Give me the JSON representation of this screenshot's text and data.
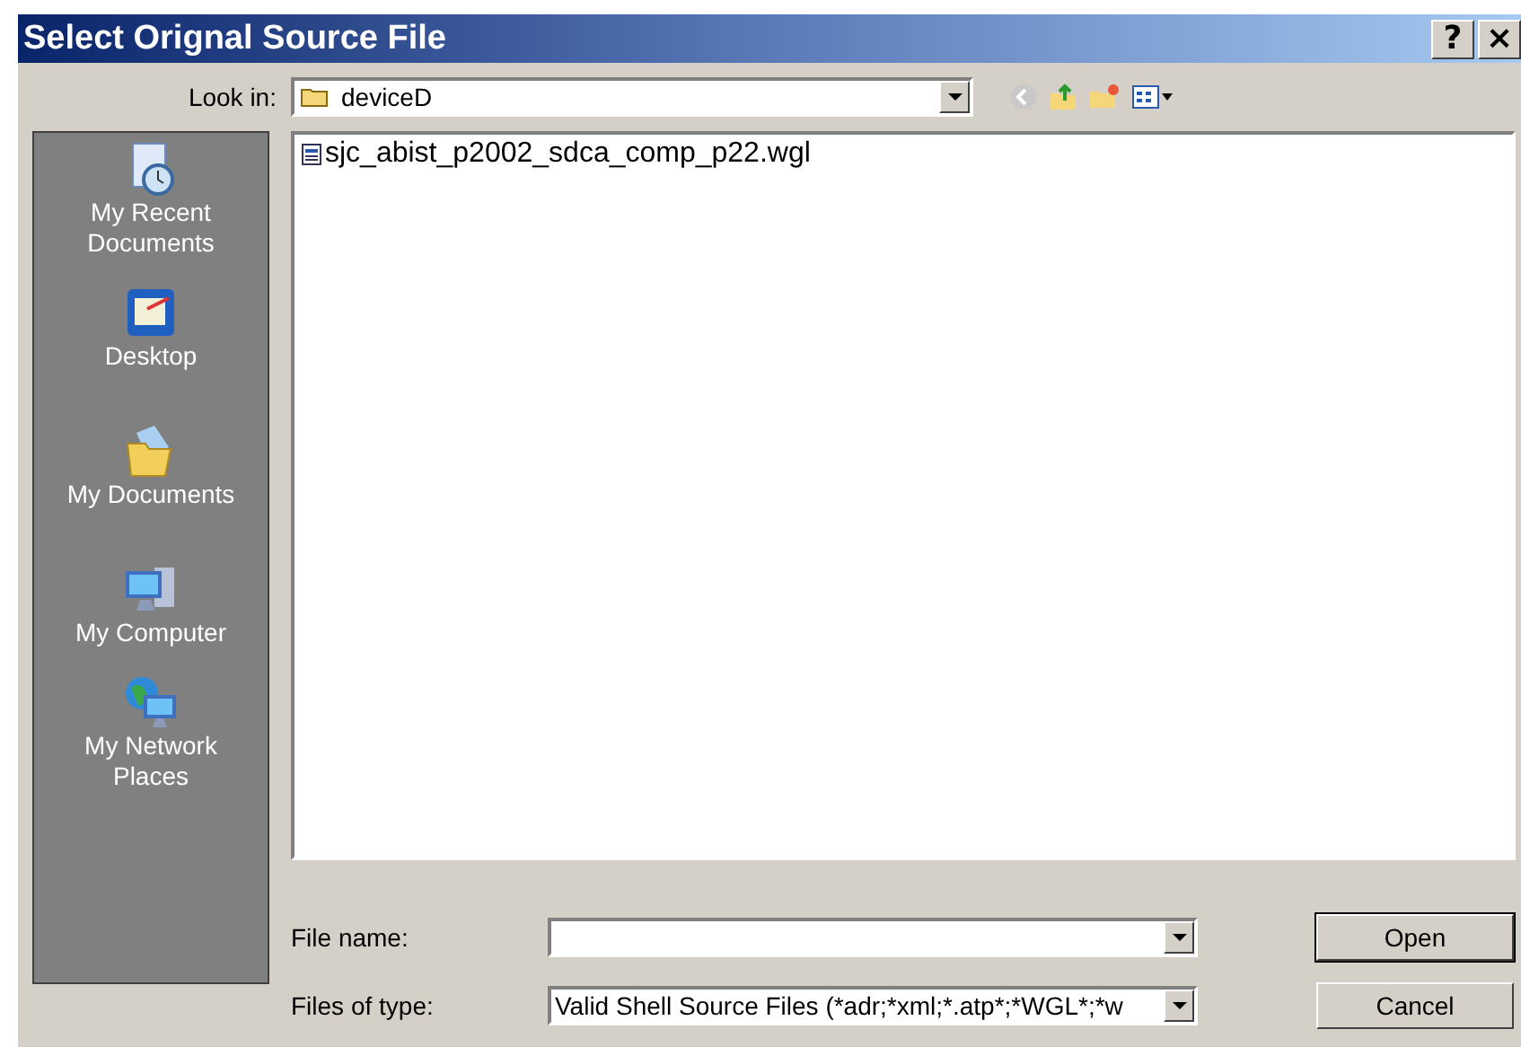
{
  "window": {
    "title": "Select Orignal Source File",
    "help_button": "?",
    "close_button": "×"
  },
  "look_in": {
    "label": "Look in:",
    "value": "deviceD"
  },
  "places": [
    {
      "kind": "recent",
      "label": "My Recent Documents"
    },
    {
      "kind": "desktop",
      "label": "Desktop"
    },
    {
      "kind": "documents",
      "label": "My Documents"
    },
    {
      "kind": "computer",
      "label": "My Computer"
    },
    {
      "kind": "network",
      "label": "My Network Places"
    }
  ],
  "files": [
    {
      "name": "sjc_abist_p2002_sdca_comp_p22.wgl",
      "selected": false
    }
  ],
  "file_name": {
    "label": "File name:"
  },
  "file_type": {
    "label": "Files of type:",
    "value": "Valid Shell Source Files (*adr;*xml;*.atp*;*WGL*;*w"
  },
  "buttons": [
    "Open",
    "Cancel"
  ]
}
